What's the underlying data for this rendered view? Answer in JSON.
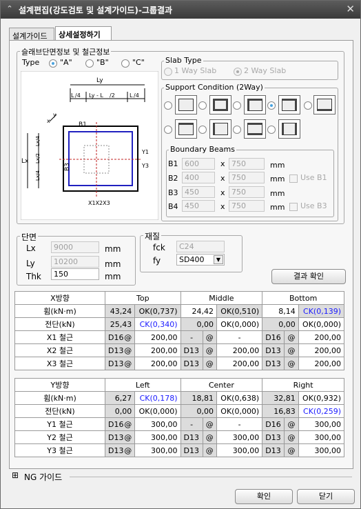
{
  "window": {
    "title": "설계편집(강도검토 및 설계가이드)-그룹결과"
  },
  "tabs": [
    {
      "label": "설계가이드"
    },
    {
      "label": "상세설정하기"
    }
  ],
  "section_info": {
    "legend": "슬래브단면정보 및 철근정보",
    "type_label": "Type",
    "type_options": [
      "\"A\"",
      "\"B\"",
      "\"C\""
    ],
    "type_selected": 0
  },
  "diagram": {
    "ly": "Ly",
    "ly_split": [
      "L",
      "/4",
      "Ly - L",
      "/2",
      "L",
      "/4"
    ],
    "lx": "Lx",
    "lx_split": [
      "Lx/4",
      "Lx/2",
      "Lx/4"
    ],
    "b1": "B1",
    "b2": "B2",
    "b3": "B3",
    "b4": "B4",
    "y1": "Y1",
    "y3": "Y3",
    "x_axis": "x",
    "y_axis": "y",
    "x123": "X1X2X3"
  },
  "slab_type": {
    "legend": "Slab Type",
    "options": [
      "1 Way Slab",
      "2 Way Slab"
    ],
    "selected": 1
  },
  "support": {
    "legend": "Support Condition (2Way)",
    "selected": 3
  },
  "boundary": {
    "legend": "Boundary Beams",
    "x_sym": "x",
    "unit": "mm",
    "rows": [
      {
        "label": "B1",
        "w": "600",
        "h": "750",
        "use": "Use B1"
      },
      {
        "label": "B2",
        "w": "400",
        "h": "750",
        "use": ""
      },
      {
        "label": "B3",
        "w": "450",
        "h": "750",
        "use": "Use B3"
      },
      {
        "label": "B4",
        "w": "450",
        "h": "750",
        "use": ""
      }
    ]
  },
  "dims": {
    "legend": "단면",
    "lx_label": "Lx",
    "lx": "9000",
    "ly_label": "Ly",
    "ly": "10200",
    "thk_label": "Thk",
    "thk": "150",
    "unit": "mm"
  },
  "material": {
    "legend": "재질",
    "fck_label": "fck",
    "fck": "C24",
    "fy_label": "fy",
    "fy": "SD400"
  },
  "confirm_button": "결과 확인",
  "x_table": {
    "head": "X방향",
    "cols": [
      "Top",
      "Middle",
      "Bottom"
    ],
    "moment": {
      "label": "휨(kN·m)",
      "vals": [
        "43,24",
        "OK(0,737)",
        "24,42",
        "OK(0,510)",
        "8,14",
        "CK(0,139)"
      ]
    },
    "shear": {
      "label": "전단(kN)",
      "vals": [
        "25,43",
        "CK(0,340)",
        "0,00",
        "OK(0,000)",
        "0,00",
        "OK(0,000)"
      ]
    },
    "rebars": [
      {
        "label": "X1 철근",
        "vals": [
          "D16",
          "@",
          "200,00",
          "-",
          "@",
          "-",
          "D16",
          "@",
          "200,00"
        ]
      },
      {
        "label": "X2 철근",
        "vals": [
          "D13",
          "@",
          "200,00",
          "D13",
          "@",
          "200,00",
          "D13",
          "@",
          "200,00"
        ]
      },
      {
        "label": "X3 철근",
        "vals": [
          "D13",
          "@",
          "200,00",
          "D13",
          "@",
          "200,00",
          "D13",
          "@",
          "200,00"
        ]
      }
    ]
  },
  "y_table": {
    "head": "Y방향",
    "cols": [
      "Left",
      "Center",
      "Right"
    ],
    "moment": {
      "label": "휨(kN·m)",
      "vals": [
        "6,27",
        "CK(0,178)",
        "18,81",
        "OK(0,638)",
        "32,81",
        "OK(0,932)"
      ]
    },
    "shear": {
      "label": "전단(kN)",
      "vals": [
        "0,00",
        "OK(0,000)",
        "0,00",
        "OK(0,000)",
        "16,83",
        "CK(0,259)"
      ]
    },
    "rebars": [
      {
        "label": "Y1 철근",
        "vals": [
          "D16",
          "@",
          "300,00",
          "-",
          "@",
          "-",
          "D16",
          "@",
          "300,00"
        ]
      },
      {
        "label": "Y2 철근",
        "vals": [
          "D13",
          "@",
          "300,00",
          "D13",
          "@",
          "300,00",
          "D13",
          "@",
          "300,00"
        ]
      },
      {
        "label": "Y3 철근",
        "vals": [
          "D13",
          "@",
          "300,00",
          "D13",
          "@",
          "300,00",
          "D13",
          "@",
          "300,00"
        ]
      }
    ]
  },
  "ng_guide": {
    "label": "NG 가이드",
    "expander": "⊞"
  },
  "ok_button": "확인",
  "close_button": "닫기",
  "colors": {
    "ok_text": "#000000",
    "ck_text": "#1a1aff",
    "radio_selected": "#4aa3df"
  }
}
